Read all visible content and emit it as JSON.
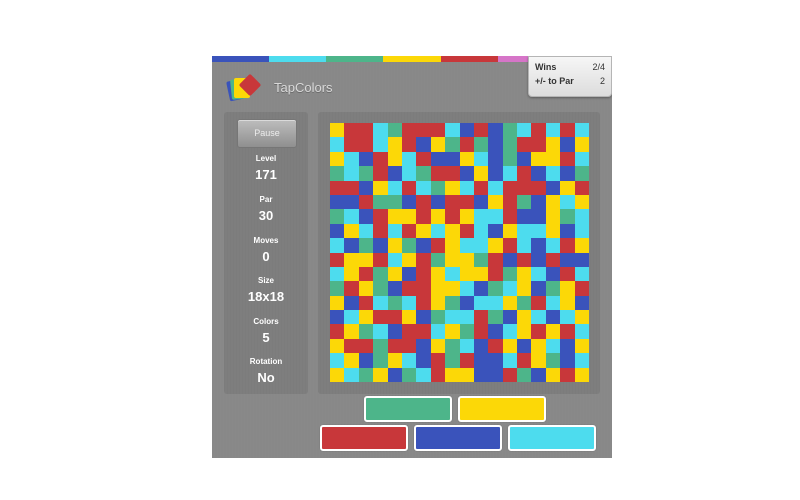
{
  "app": {
    "title": "TapColors"
  },
  "palette": {
    "green": "#4db58a",
    "yellow": "#fcd807",
    "red": "#c8373a",
    "blue": "#3a53bb",
    "cyan": "#4ddcee"
  },
  "stripe_colors": [
    "#3a53bb",
    "#4ddcee",
    "#4db58a",
    "#fcd807",
    "#c8373a",
    "#d675c8",
    "#e08a3c"
  ],
  "wins": {
    "label": "Wins",
    "value": "2/4",
    "par_label": "+/- to Par",
    "par_value": "2"
  },
  "controls": {
    "pause_label": "Pause"
  },
  "stats": [
    {
      "label": "Level",
      "value": "171"
    },
    {
      "label": "Par",
      "value": "30"
    },
    {
      "label": "Moves",
      "value": "0"
    },
    {
      "label": "Size",
      "value": "18x18"
    },
    {
      "label": "Colors",
      "value": "5"
    },
    {
      "label": "Rotation",
      "value": "No"
    }
  ],
  "board": {
    "rows": 18,
    "cols": 18,
    "cells": [
      "YRRCGRRRCBRBGCRCRC",
      "CRRCYRBYGRGBGRRYBY",
      "YCBRYCRBBYCBGBYYRC",
      "GCGRBCGRRBYBCRBCBG",
      "RRBYCRCGYCRCRRRBYR",
      "BBRGGBRBRRBYRGBYCY",
      "GCBRYYRYRYCCRBBYGC",
      "BYCRCRYCYRCBYCCYBC",
      "CBGBYGBRYCCYRCBCRY",
      "RYYRCYRGYYGRBRBRBB",
      "CYRGYBRYCYYRGYCBRC",
      "GRYGBRRYYCBGCYBGYR",
      "YBRCGCRYGBCCYGRCYB",
      "BCYRRYBGCCRGBYCBCY",
      "RYGCBRRCYGRBCYRYRC",
      "YRRGRRBYGCBRYBYCBY",
      "CYBGYCBRGRBBCRYGBC",
      "YCGYBGCRYYBBRGBYRY"
    ]
  },
  "color_buttons": [
    "green",
    "yellow",
    "red",
    "blue",
    "cyan"
  ]
}
